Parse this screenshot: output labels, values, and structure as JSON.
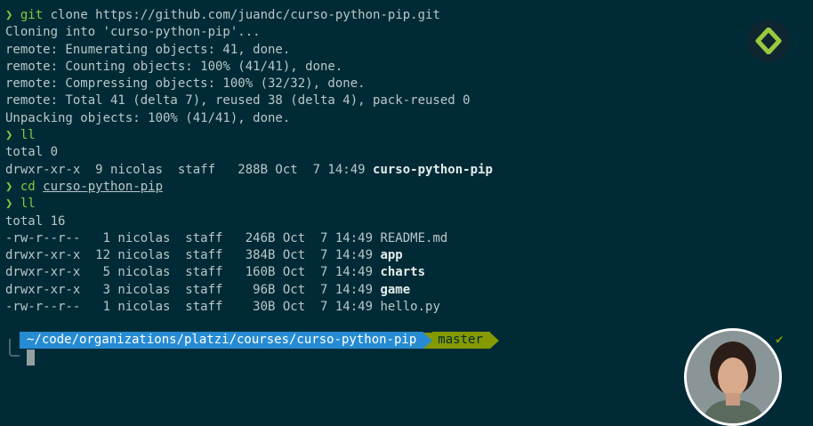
{
  "prompt_symbol": "❯",
  "lines": [
    {
      "kind": "prompt",
      "cmd": "git",
      "args": " clone https://github.com/juandc/curso-python-pip.git"
    },
    {
      "kind": "out",
      "text": "Cloning into 'curso-python-pip'..."
    },
    {
      "kind": "out",
      "text": "remote: Enumerating objects: 41, done."
    },
    {
      "kind": "out",
      "text": "remote: Counting objects: 100% (41/41), done."
    },
    {
      "kind": "out",
      "text": "remote: Compressing objects: 100% (32/32), done."
    },
    {
      "kind": "out",
      "text": "remote: Total 41 (delta 7), reused 38 (delta 4), pack-reused 0"
    },
    {
      "kind": "out",
      "text": "Unpacking objects: 100% (41/41), done."
    },
    {
      "kind": "prompt",
      "cmd": "ll",
      "args": ""
    },
    {
      "kind": "out",
      "text": "total 0"
    },
    {
      "kind": "ls",
      "meta": "drwxr-xr-x  9 nicolas  staff   288B Oct  7 14:49 ",
      "name": "curso-python-pip",
      "bold": true
    },
    {
      "kind": "prompt_link",
      "cmd": "cd",
      "link": "curso-python-pip"
    },
    {
      "kind": "prompt",
      "cmd": "ll",
      "args": ""
    },
    {
      "kind": "out",
      "text": "total 16"
    },
    {
      "kind": "ls",
      "meta": "-rw-r--r--   1 nicolas  staff   246B Oct  7 14:49 ",
      "name": "README.md",
      "bold": false
    },
    {
      "kind": "ls",
      "meta": "drwxr-xr-x  12 nicolas  staff   384B Oct  7 14:49 ",
      "name": "app",
      "bold": true
    },
    {
      "kind": "ls",
      "meta": "drwxr-xr-x   5 nicolas  staff   160B Oct  7 14:49 ",
      "name": "charts",
      "bold": true
    },
    {
      "kind": "ls",
      "meta": "drwxr-xr-x   3 nicolas  staff    96B Oct  7 14:49 ",
      "name": "game",
      "bold": true
    },
    {
      "kind": "ls",
      "meta": "-rw-r--r--   1 nicolas  staff    30B Oct  7 14:49 ",
      "name": "hello.py",
      "bold": false
    }
  ],
  "powerline": {
    "directory": "~/code/organizations/platzi/courses/curso-python-pip",
    "branch": "master"
  },
  "status_check": "✔",
  "icons": {
    "logo": "platzi-logo-icon",
    "avatar": "presenter-webcam-avatar"
  },
  "colors": {
    "background": "#002b36",
    "prompt_green": "#85c940",
    "dir_blue": "#268bd2",
    "branch_olive": "#859900"
  }
}
